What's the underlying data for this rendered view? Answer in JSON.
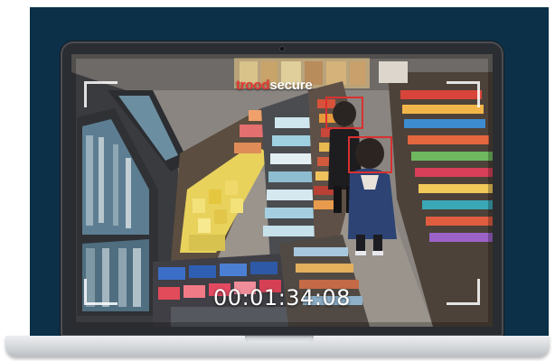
{
  "video_feed": {
    "brand": {
      "part1": "trood",
      "part2": "secure",
      "part1_color": "#e53935",
      "part2_color": "#ffffff"
    },
    "timestamp": "00:01:34:08",
    "detection_color": "#d93030"
  },
  "colors": {
    "backdrop": "#0b3048",
    "laptop_bezel": "#2a2d31",
    "laptop_base": "#d8dbde"
  }
}
